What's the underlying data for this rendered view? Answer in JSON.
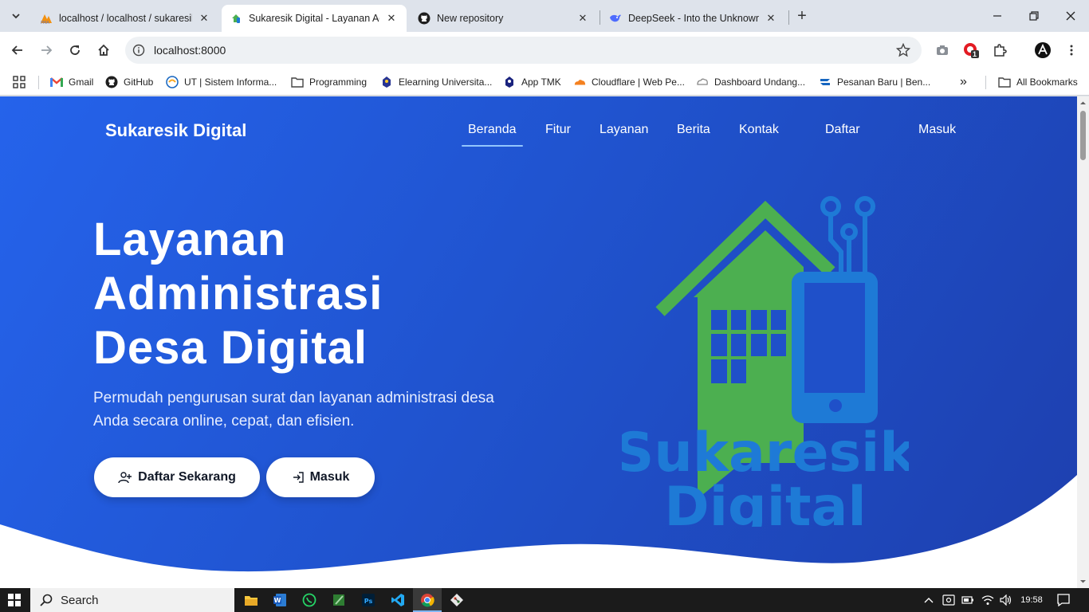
{
  "browser": {
    "tabs": [
      {
        "title": "localhost / localhost / sukaresik",
        "active": false,
        "favicon": "phpmyadmin-icon"
      },
      {
        "title": "Sukaresik Digital - Layanan Administrasi",
        "active": true,
        "favicon": "site-icon"
      },
      {
        "title": "New repository",
        "active": false,
        "favicon": "github-icon"
      },
      {
        "title": "DeepSeek - Into the Unknown",
        "active": false,
        "favicon": "deepseek-icon"
      }
    ],
    "url": "localhost:8000",
    "bookmarks": [
      {
        "label": "Gmail",
        "icon": "gmail-icon"
      },
      {
        "label": "GitHub",
        "icon": "github-icon"
      },
      {
        "label": "UT | Sistem Informa...",
        "icon": "ut-icon"
      },
      {
        "label": "Programming",
        "icon": "folder-icon"
      },
      {
        "label": "Elearning Universita...",
        "icon": "elearning-icon"
      },
      {
        "label": "App TMK",
        "icon": "app-icon"
      },
      {
        "label": "Cloudflare | Web Pe...",
        "icon": "cloudflare-icon"
      },
      {
        "label": "Dashboard Undang...",
        "icon": "dashboard-icon"
      },
      {
        "label": "Pesanan Baru | Ben...",
        "icon": "pesanan-icon"
      }
    ],
    "all_bookmarks": "All Bookmarks",
    "extension_badge": "1"
  },
  "page": {
    "brand": "Sukaresik Digital",
    "nav": [
      {
        "label": "Beranda",
        "active": true
      },
      {
        "label": "Fitur",
        "active": false
      },
      {
        "label": "Layanan",
        "active": false
      },
      {
        "label": "Berita",
        "active": false
      },
      {
        "label": "Kontak",
        "active": false
      },
      {
        "label": "Daftar",
        "active": false
      },
      {
        "label": "Masuk",
        "active": false
      }
    ],
    "hero": {
      "title_line1": "Layanan",
      "title_line2": "Administrasi",
      "title_line3": "Desa Digital",
      "subtitle": "Permudah pengurusan surat dan layanan administrasi desa Anda secara online, cepat, dan efisien.",
      "primary_button": "Daftar Sekarang",
      "secondary_button": "Masuk"
    },
    "logo_text_line1": "Sukaresik",
    "logo_text_line2": "Digital",
    "colors": {
      "hero_start": "#2563eb",
      "hero_end": "#1e3fae",
      "logo_green": "#4caf50",
      "logo_blue": "#1e7ad6"
    }
  },
  "taskbar": {
    "search_label": "Search",
    "time": "19:58",
    "apps": [
      "file-explorer-icon",
      "word-icon",
      "whatsapp-icon",
      "notepad-icon",
      "photoshop-icon",
      "vscode-icon",
      "chrome-icon",
      "git-icon"
    ]
  }
}
